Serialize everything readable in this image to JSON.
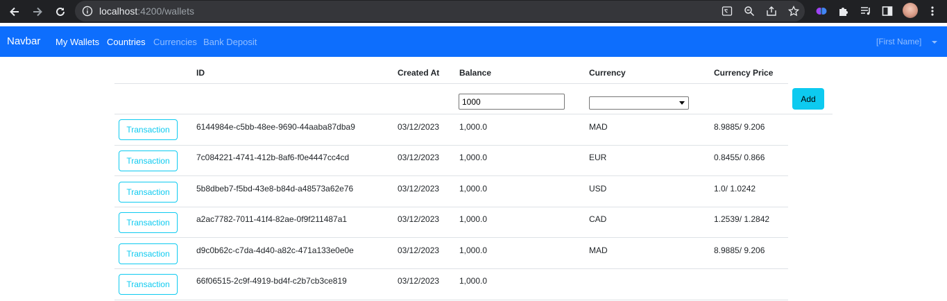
{
  "browser": {
    "url_host": "localhost",
    "url_path": ":4200/wallets"
  },
  "navbar": {
    "brand": "Navbar",
    "links": [
      "My Wallets",
      "Countries",
      "Currencies",
      "Bank Deposit"
    ],
    "user": "[First Name]"
  },
  "table": {
    "headers": [
      "ID",
      "Created At",
      "Balance",
      "Currency",
      "Currency Price"
    ],
    "new_row": {
      "balance_value": "1000",
      "currency_value": "",
      "add_label": "Add"
    },
    "transaction_label": "Transaction",
    "rows": [
      {
        "id": "6144984e-c5bb-48ee-9690-44aaba87dba9",
        "created": "03/12/2023",
        "balance": "1,000.0",
        "currency": "MAD",
        "price": "8.9885/ 9.206"
      },
      {
        "id": "7c084221-4741-412b-8af6-f0e4447cc4cd",
        "created": "03/12/2023",
        "balance": "1,000.0",
        "currency": "EUR",
        "price": "0.8455/ 0.866"
      },
      {
        "id": "5b8dbeb7-f5bd-43e8-b84d-a48573a62e76",
        "created": "03/12/2023",
        "balance": "1,000.0",
        "currency": "USD",
        "price": "1.0/ 1.0242"
      },
      {
        "id": "a2ac7782-7011-41f4-82ae-0f9f211487a1",
        "created": "03/12/2023",
        "balance": "1,000.0",
        "currency": "CAD",
        "price": "1.2539/ 1.2842"
      },
      {
        "id": "d9c0b62c-c7da-4d40-a82c-471a133e0e0e",
        "created": "03/12/2023",
        "balance": "1,000.0",
        "currency": "MAD",
        "price": "8.9885/ 9.206"
      },
      {
        "id": "66f06515-2c9f-4919-bd4f-c2b7cb3ce819",
        "created": "03/12/2023",
        "balance": "1,000.0",
        "currency": "",
        "price": ""
      }
    ]
  },
  "colors": {
    "navbar": "#0d6efd",
    "accent": "#0dcaf0",
    "chrome": "#202124"
  }
}
